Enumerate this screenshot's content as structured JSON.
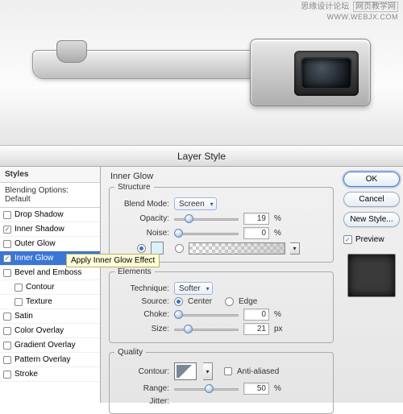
{
  "watermark": {
    "line1": "思缘设计论坛",
    "line2": "WWW.WEBJX.COM",
    "line_badge": "网页教学网"
  },
  "dialog": {
    "title": "Layer Style"
  },
  "left": {
    "header": "Styles",
    "subheader": "Blending Options: Default",
    "items": [
      {
        "label": "Drop Shadow",
        "checked": false
      },
      {
        "label": "Inner Shadow",
        "checked": true
      },
      {
        "label": "Outer Glow",
        "checked": false
      },
      {
        "label": "Inner Glow",
        "checked": true,
        "highlight": true
      },
      {
        "label": "Bevel and Emboss",
        "checked": false
      },
      {
        "label": "Contour",
        "checked": false,
        "indent": true
      },
      {
        "label": "Texture",
        "checked": false,
        "indent": true
      },
      {
        "label": "Satin",
        "checked": false
      },
      {
        "label": "Color Overlay",
        "checked": false
      },
      {
        "label": "Gradient Overlay",
        "checked": false
      },
      {
        "label": "Pattern Overlay",
        "checked": false
      },
      {
        "label": "Stroke",
        "checked": false
      }
    ],
    "tooltip": "Apply Inner Glow Effect"
  },
  "mid": {
    "section": "Inner Glow",
    "structure": {
      "legend": "Structure",
      "blend_label": "Blend Mode:",
      "blend_value": "Screen",
      "opacity_label": "Opacity:",
      "opacity_value": "19",
      "opacity_unit": "%",
      "noise_label": "Noise:",
      "noise_value": "0",
      "noise_unit": "%"
    },
    "elements": {
      "legend": "Elements",
      "technique_label": "Technique:",
      "technique_value": "Softer",
      "source_label": "Source:",
      "source_center": "Center",
      "source_edge": "Edge",
      "source_sel": "center",
      "choke_label": "Choke:",
      "choke_value": "0",
      "choke_unit": "%",
      "size_label": "Size:",
      "size_value": "21",
      "size_unit": "px"
    },
    "quality": {
      "legend": "Quality",
      "contour_label": "Contour:",
      "anti_label": "Anti-aliased",
      "range_label": "Range:",
      "range_value": "50",
      "range_unit": "%",
      "jitter_label": "Jitter:"
    }
  },
  "right": {
    "ok": "OK",
    "cancel": "Cancel",
    "newstyle": "New Style...",
    "preview": "Preview"
  }
}
